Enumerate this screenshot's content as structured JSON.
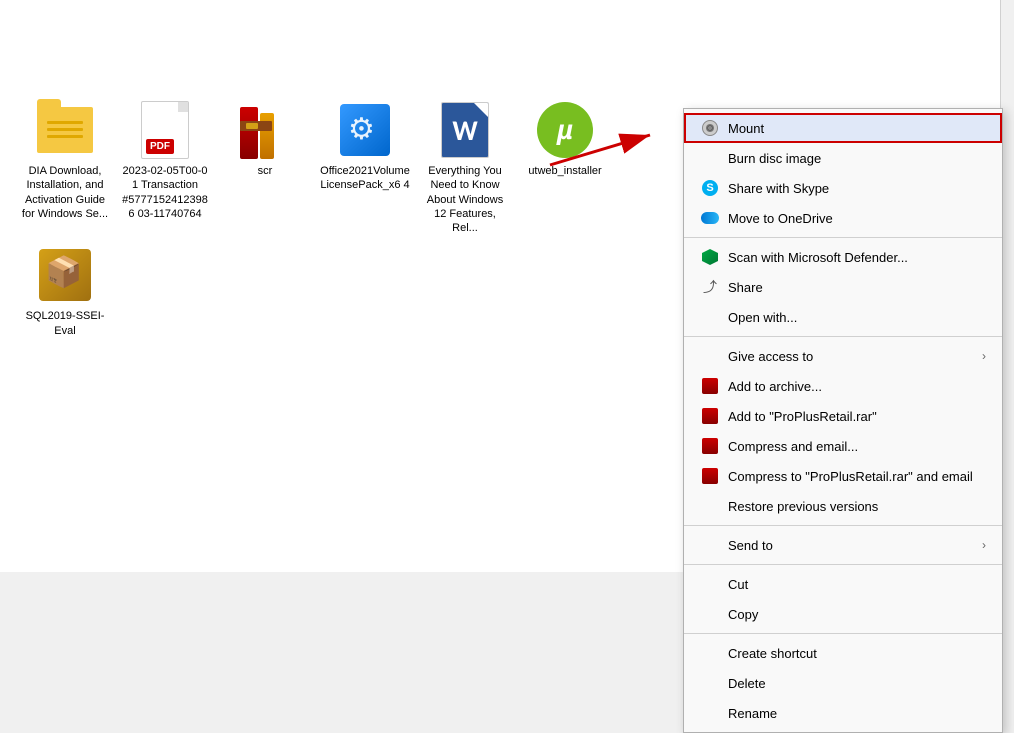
{
  "background": "#ffffff",
  "files": [
    {
      "id": "folder-dia",
      "type": "folder",
      "label": "DIA Download, Installation, and Activation Guide for Windows Se..."
    },
    {
      "id": "pdf-transaction",
      "type": "pdf",
      "label": "2023-02-05T00-0 1 Transaction #57771524123986 03-11740764"
    },
    {
      "id": "winrar-scr",
      "type": "winrar",
      "label": "scr"
    },
    {
      "id": "office-license",
      "type": "setup",
      "label": "Office2021VolumeLicensePack_x6 4"
    },
    {
      "id": "word-everything",
      "type": "word",
      "label": "Everything You Need to Know About Windows 12 Features, Rel..."
    },
    {
      "id": "utorrent-installer",
      "type": "utorrent",
      "label": "utweb_installer"
    },
    {
      "id": "sql-eval",
      "type": "package",
      "label": "SQL2019-SSEI-Eval"
    }
  ],
  "contextMenu": {
    "items": [
      {
        "id": "mount",
        "label": "Mount",
        "icon": "disc",
        "highlighted": true,
        "hasSubmenu": false
      },
      {
        "id": "burn-disc",
        "label": "Burn disc image",
        "icon": "none",
        "highlighted": false,
        "hasSubmenu": false
      },
      {
        "id": "share-skype",
        "label": "Share with Skype",
        "icon": "skype",
        "highlighted": false,
        "hasSubmenu": false
      },
      {
        "id": "move-onedrive",
        "label": "Move to OneDrive",
        "icon": "onedrive",
        "highlighted": false,
        "hasSubmenu": false
      },
      {
        "separator": true
      },
      {
        "id": "scan-defender",
        "label": "Scan with Microsoft Defender...",
        "icon": "defender",
        "highlighted": false,
        "hasSubmenu": false
      },
      {
        "id": "share",
        "label": "Share",
        "icon": "share",
        "highlighted": false,
        "hasSubmenu": false
      },
      {
        "id": "open-with",
        "label": "Open with...",
        "icon": "none",
        "highlighted": false,
        "hasSubmenu": false
      },
      {
        "separator": true
      },
      {
        "id": "give-access",
        "label": "Give access to",
        "icon": "none",
        "highlighted": false,
        "hasSubmenu": true
      },
      {
        "id": "add-archive",
        "label": "Add to archive...",
        "icon": "winrar",
        "highlighted": false,
        "hasSubmenu": false
      },
      {
        "id": "add-proplusretail",
        "label": "Add to \"ProPlusRetail.rar\"",
        "icon": "winrar",
        "highlighted": false,
        "hasSubmenu": false
      },
      {
        "id": "compress-email",
        "label": "Compress and email...",
        "icon": "winrar",
        "highlighted": false,
        "hasSubmenu": false
      },
      {
        "id": "compress-proplusretail-email",
        "label": "Compress to \"ProPlusRetail.rar\" and email",
        "icon": "winrar",
        "highlighted": false,
        "hasSubmenu": false
      },
      {
        "id": "restore-versions",
        "label": "Restore previous versions",
        "icon": "none",
        "highlighted": false,
        "hasSubmenu": false
      },
      {
        "separator": true
      },
      {
        "id": "send-to",
        "label": "Send to",
        "icon": "none",
        "highlighted": false,
        "hasSubmenu": true
      },
      {
        "separator": true
      },
      {
        "id": "cut",
        "label": "Cut",
        "icon": "none",
        "highlighted": false,
        "hasSubmenu": false
      },
      {
        "id": "copy",
        "label": "Copy",
        "icon": "none",
        "highlighted": false,
        "hasSubmenu": false
      },
      {
        "separator": true
      },
      {
        "id": "create-shortcut",
        "label": "Create shortcut",
        "icon": "none",
        "highlighted": false,
        "hasSubmenu": false
      },
      {
        "id": "delete",
        "label": "Delete",
        "icon": "none",
        "highlighted": false,
        "hasSubmenu": false
      },
      {
        "id": "rename",
        "label": "Rename",
        "icon": "none",
        "highlighted": false,
        "hasSubmenu": false
      }
    ]
  }
}
